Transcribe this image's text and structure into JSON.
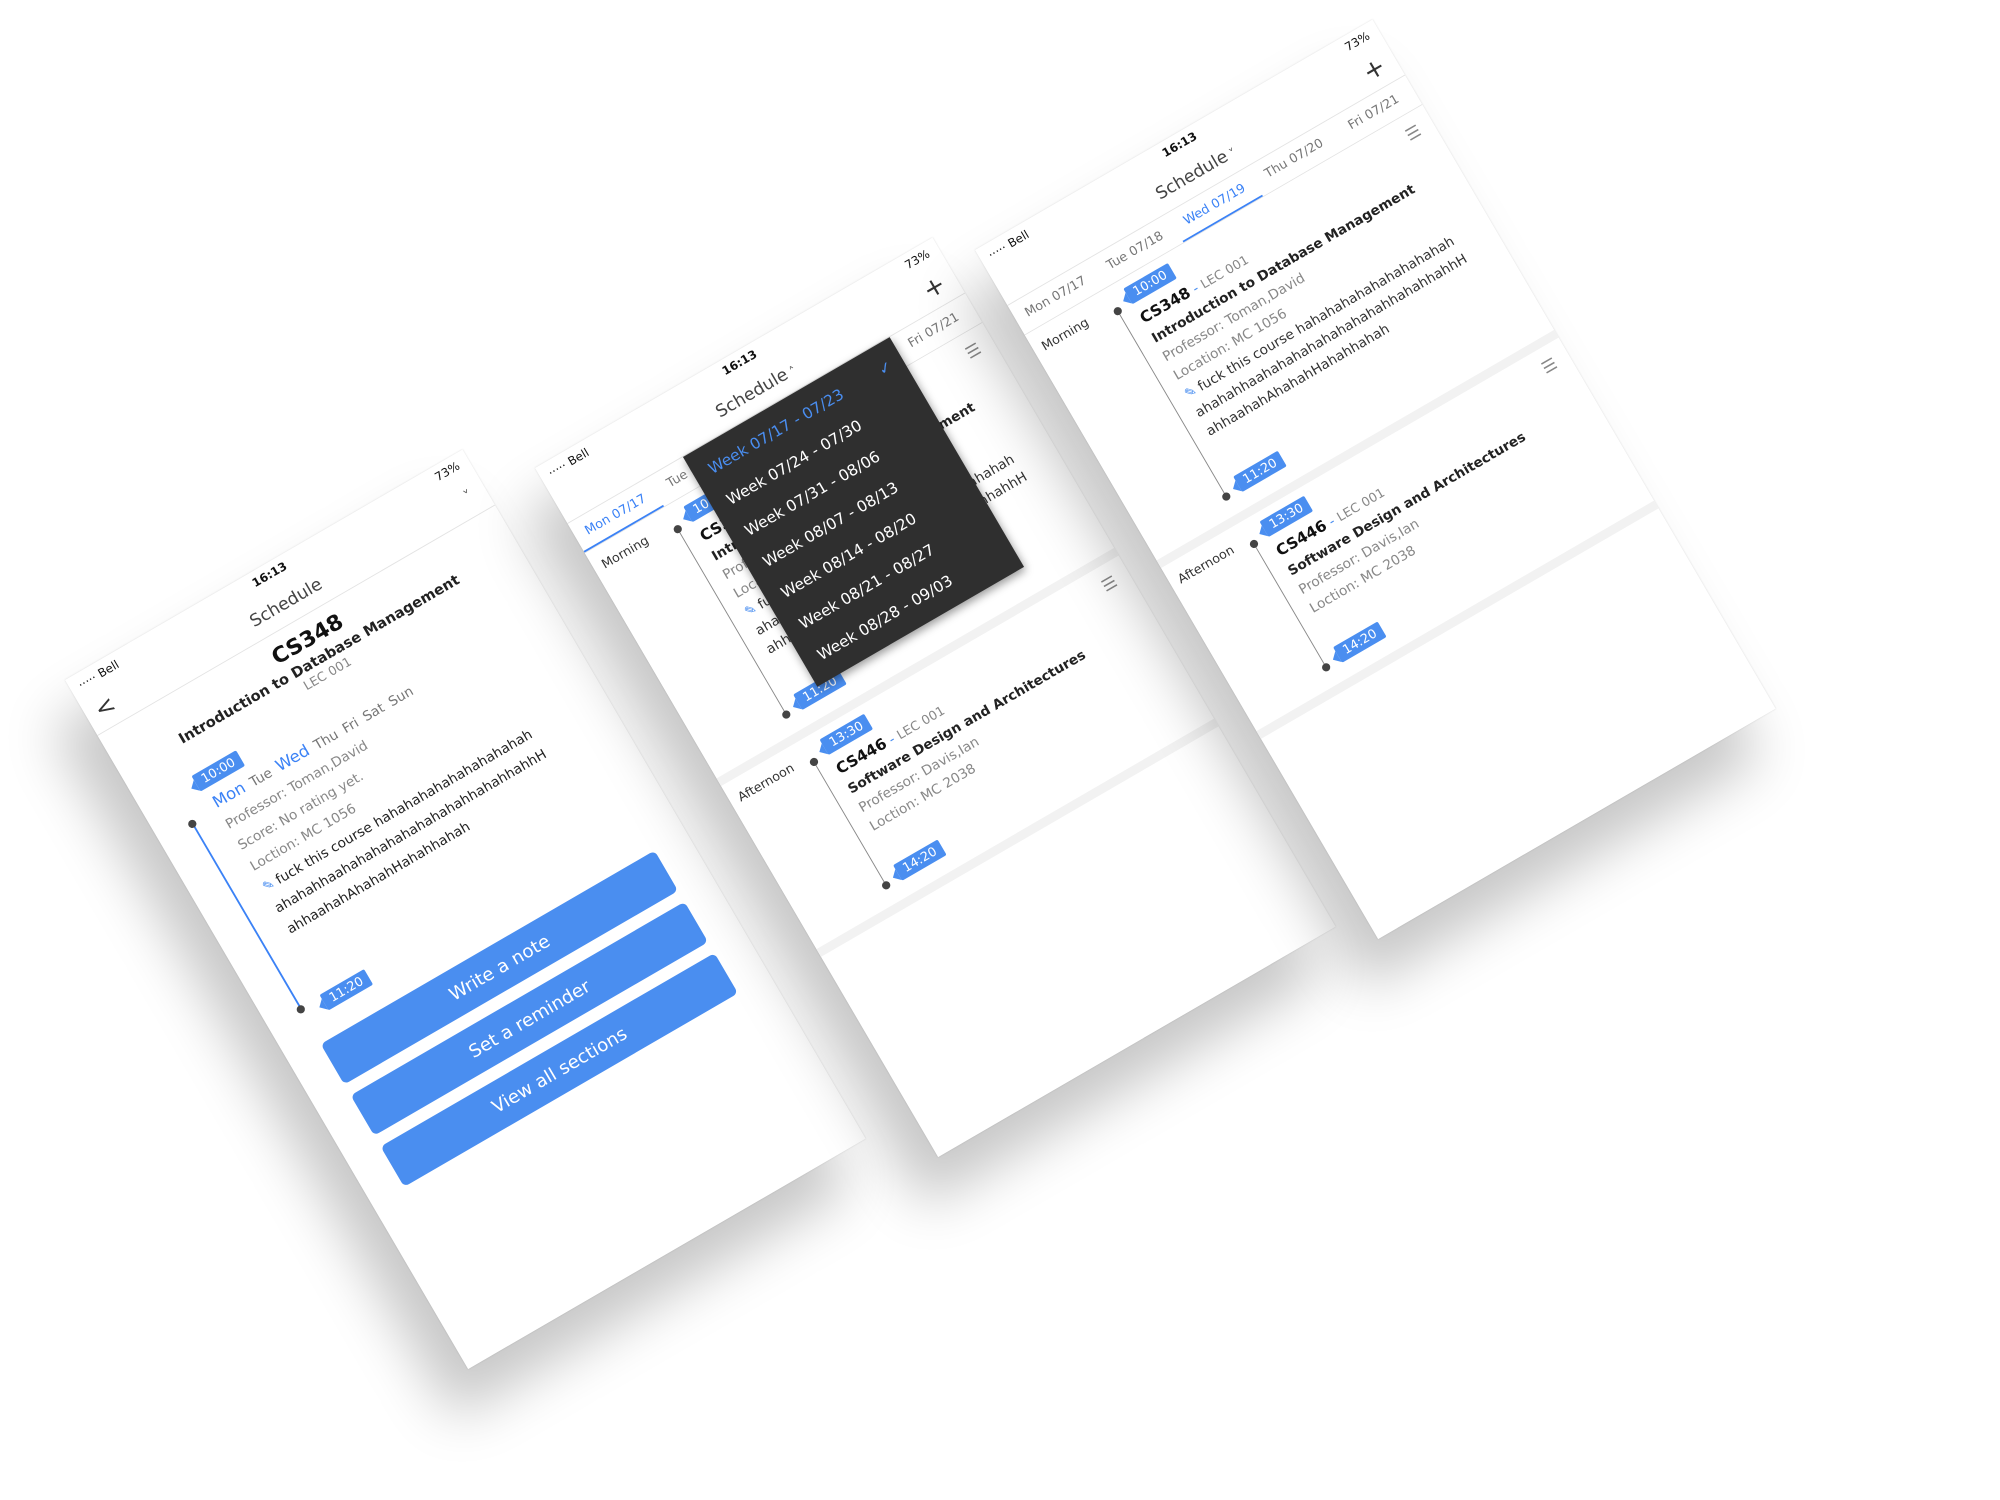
{
  "status": {
    "carrier": "····· Bell",
    "time": "16:13",
    "battery": "73%"
  },
  "nav": {
    "title": "Schedule",
    "caret_down": "˅",
    "caret_up": "˄",
    "plus": "+",
    "back": "<"
  },
  "detail": {
    "code": "CS348",
    "name": "Introduction to Database Management",
    "section": "LEC 001",
    "start": "10:00",
    "end": "11:20",
    "days": [
      {
        "label": "Mon",
        "active": true
      },
      {
        "label": "Tue",
        "active": false
      },
      {
        "label": "Wed",
        "active": true
      },
      {
        "label": "Thu",
        "active": false
      },
      {
        "label": "Fri",
        "active": false
      },
      {
        "label": "Sat",
        "active": false
      },
      {
        "label": "Sun",
        "active": false
      }
    ],
    "professor": "Professor: Toman,David",
    "score": "Score: No rating yet.",
    "location": "Loction: MC 1056",
    "note_line1": "fuck this course hahahahahahahahahahah",
    "note_line2": "ahahahhaahahahahahahahahahhahahhahhH",
    "note_line3": "ahhaahahAhahahHahahhahah",
    "buttons": {
      "note": "Write a note",
      "reminder": "Set a reminder",
      "sections": "View all sections"
    }
  },
  "schedule": {
    "tabs": [
      "Mon 07/17",
      "Tue 07/18",
      "Wed 07/19",
      "Thu 07/20",
      "Fri 07/21"
    ],
    "morning_label": "Morning",
    "afternoon_label": "Afternoon",
    "class1": {
      "code": "CS348",
      "section": "LEC 001",
      "name": "Introduction to Database Management",
      "professor": "Professor: Toman,David",
      "location": "Location: MC 1056",
      "note_line1": "fuck this course hahahahahahahahahahah",
      "note_line2": "ahahahhaahahahahahahahahahhahahhahhH",
      "note_line3": "ahhaahahAhahahHahahhahah",
      "start": "10:00",
      "end": "11:20"
    },
    "class2": {
      "code": "CS446",
      "section": "LEC 001",
      "name": "Software Design and Architectures",
      "professor": "Professor: Davis,Ian",
      "location": "Loction: MC 2038",
      "start": "13:30",
      "end": "14:20"
    }
  },
  "weeks": [
    {
      "label": "Week 07/17 - 07/23",
      "selected": true
    },
    {
      "label": "Week 07/24 - 07/30",
      "selected": false
    },
    {
      "label": "Week 07/31 - 08/06",
      "selected": false
    },
    {
      "label": "Week 08/07 - 08/13",
      "selected": false
    },
    {
      "label": "Week 08/14 - 08/20",
      "selected": false
    },
    {
      "label": "Week 08/21 - 08/27",
      "selected": false
    },
    {
      "label": "Week 08/28 - 09/03",
      "selected": false
    }
  ],
  "checkmark": "✓",
  "colors": {
    "accent": "#4a8ef0",
    "dropdown_bg": "#2f2f2f"
  }
}
